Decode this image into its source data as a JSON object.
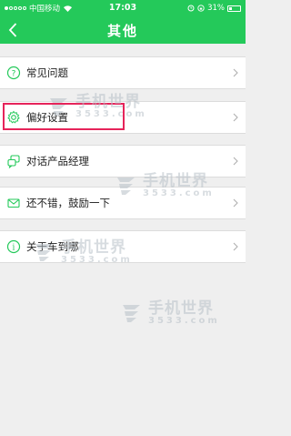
{
  "status_bar": {
    "carrier": "中国移动",
    "time": "17:03",
    "battery": "31%",
    "battery_level": 0.31
  },
  "nav": {
    "title": "其他"
  },
  "menu": [
    {
      "label": "常见问题",
      "icon": "question-circle-icon"
    },
    {
      "label": "偏好设置",
      "icon": "gear-icon"
    },
    {
      "label": "对话产品经理",
      "icon": "chat-bubbles-icon"
    },
    {
      "label": "还不错，鼓励一下",
      "icon": "envelope-icon"
    },
    {
      "label": "关于车到哪",
      "icon": "info-circle-icon"
    }
  ],
  "watermark": {
    "title": "手机世界",
    "subtitle": "3533.com"
  },
  "colors": {
    "accent": "#24c95a",
    "highlight": "#e6245a"
  }
}
